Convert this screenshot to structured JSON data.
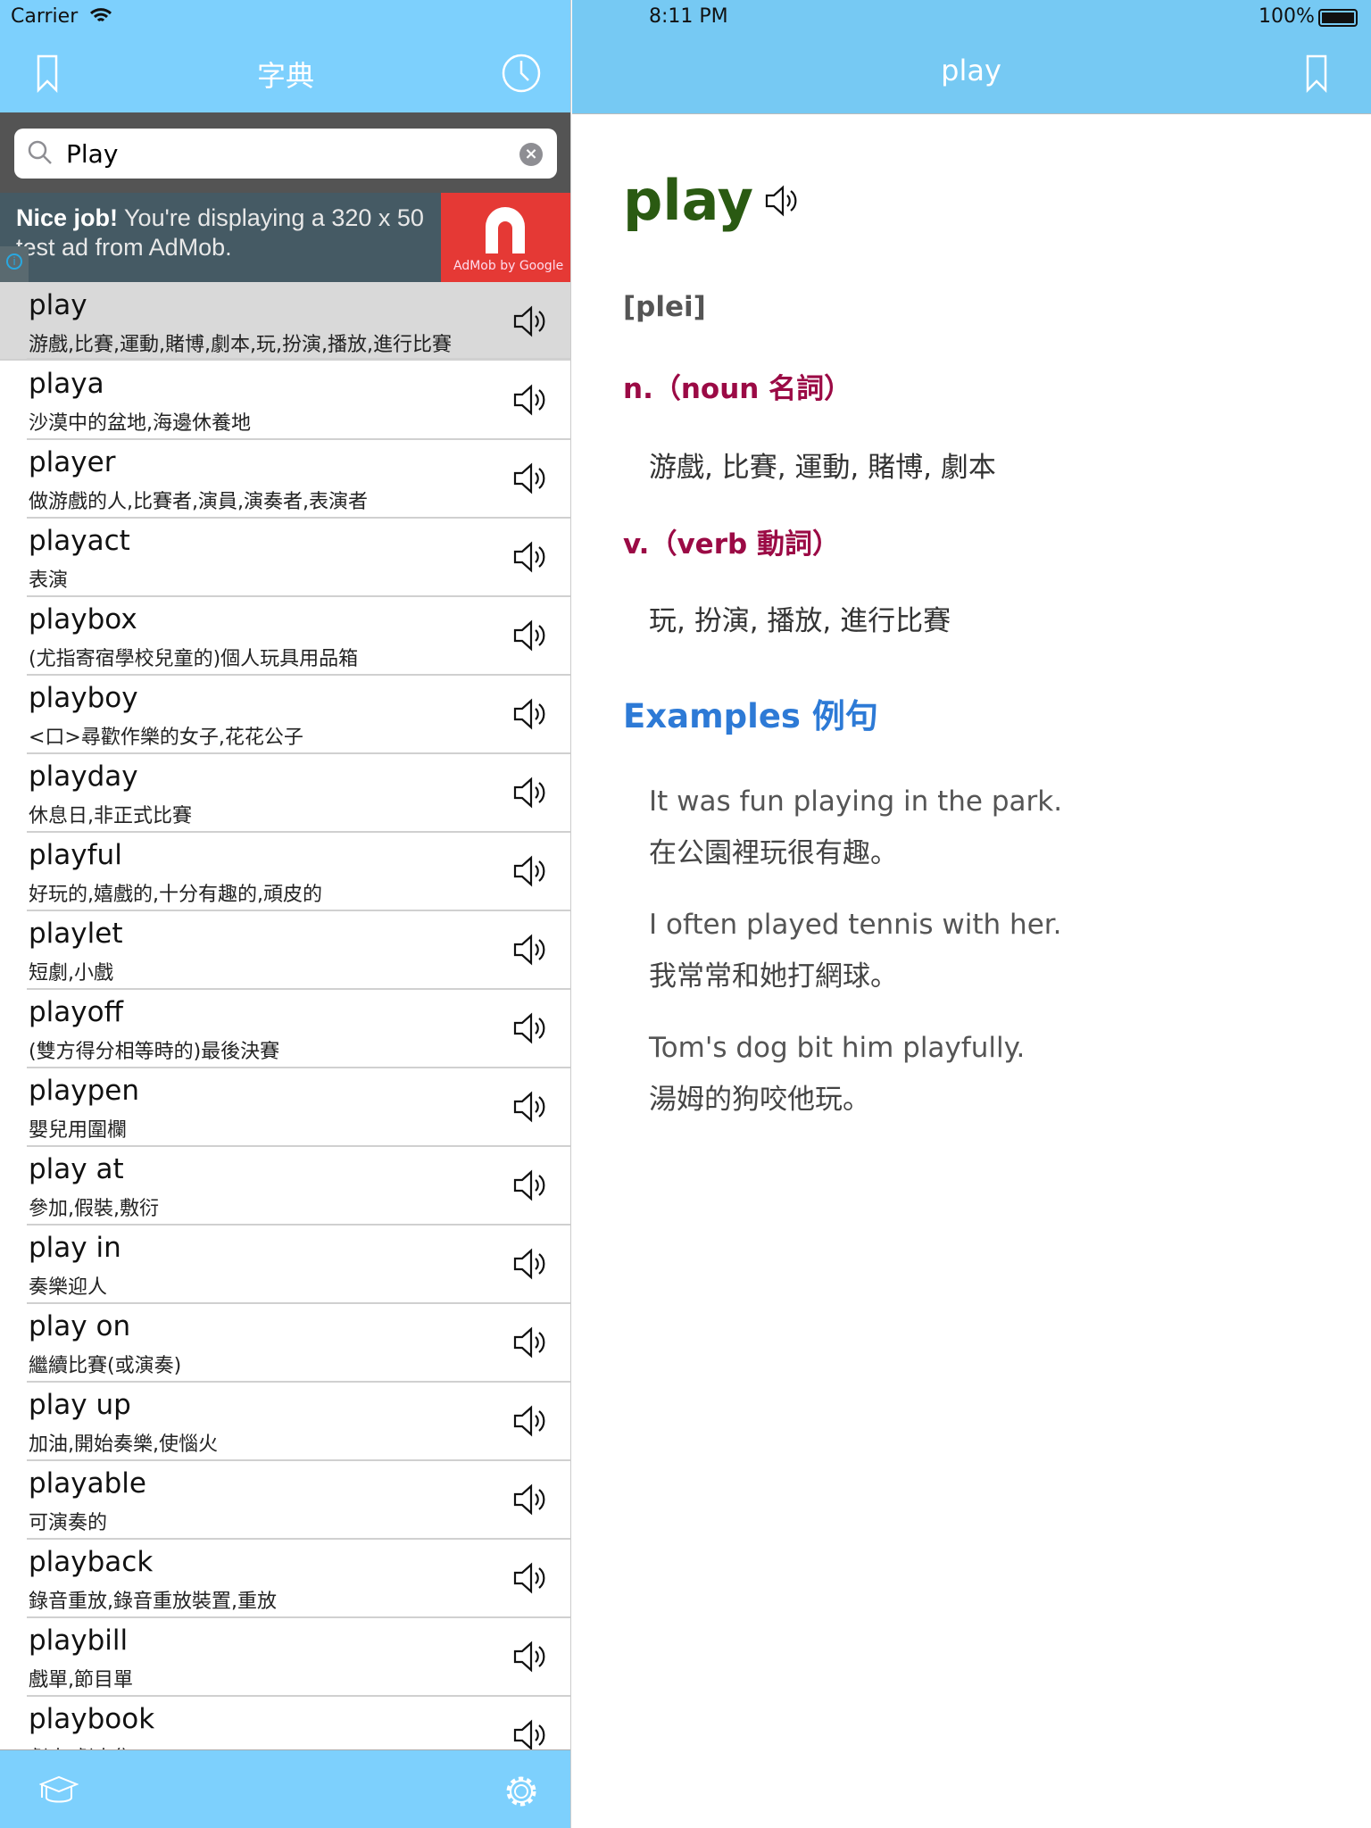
{
  "status": {
    "carrier": "Carrier",
    "time": "8:11 PM",
    "battery": "100%"
  },
  "left_nav": {
    "title": "字典",
    "left_icon": "bookmark-icon",
    "right_icon": "clock-icon"
  },
  "search": {
    "value": "Play",
    "placeholder": ""
  },
  "ad": {
    "bold": "Nice job!",
    "text": " You're displaying a 320 x 50 test ad from AdMob.",
    "logo_text": "AdMob by Google"
  },
  "results": [
    {
      "word": "play",
      "def": "游戲,比賽,運動,賭博,劇本,玩,扮演,播放,進行比賽"
    },
    {
      "word": "playa",
      "def": "沙漠中的盆地,海邊休養地"
    },
    {
      "word": "player",
      "def": "做游戲的人,比賽者,演員,演奏者,表演者"
    },
    {
      "word": "playact",
      "def": "表演"
    },
    {
      "word": "playbox",
      "def": "(尤指寄宿學校兒童的)個人玩具用品箱"
    },
    {
      "word": "playboy",
      "def": "<口>尋歡作樂的女子,花花公子"
    },
    {
      "word": "playday",
      "def": "休息日,非正式比賽"
    },
    {
      "word": "playful",
      "def": "好玩的,嬉戲的,十分有趣的,頑皮的"
    },
    {
      "word": "playlet",
      "def": "短劇,小戲"
    },
    {
      "word": "playoff",
      "def": "(雙方得分相等時的)最後決賽"
    },
    {
      "word": "playpen",
      "def": "嬰兒用圍欄"
    },
    {
      "word": "play at",
      "def": "參加,假裝,敷衍"
    },
    {
      "word": "play in",
      "def": "奏樂迎人"
    },
    {
      "word": "play on",
      "def": "繼續比賽(或演奏)"
    },
    {
      "word": "play up",
      "def": "加油,開始奏樂,使惱火"
    },
    {
      "word": "playable",
      "def": "可演奏的"
    },
    {
      "word": "playback",
      "def": "錄音重放,錄音重放裝置,重放"
    },
    {
      "word": "playbill",
      "def": "戲單,節目單"
    },
    {
      "word": "playbook",
      "def": "劇本,劇本集"
    }
  ],
  "selected_index": 0,
  "toolbar": {
    "left_icon": "graduation-cap-icon",
    "right_icon": "gear-icon"
  },
  "right_nav": {
    "title": "play",
    "right_icon": "bookmark-icon"
  },
  "entry": {
    "word": "play",
    "phonetic": "[plei]",
    "senses": [
      {
        "pos": "n.（noun 名詞）",
        "def": "游戲, 比賽, 運動, 賭博, 劇本"
      },
      {
        "pos": "v.（verb 動詞）",
        "def": "玩, 扮演, 播放, 進行比賽"
      }
    ],
    "examples_heading": "Examples 例句",
    "examples": [
      {
        "en": "It was fun playing in the park.",
        "zh": "在公園裡玩很有趣。"
      },
      {
        "en": "I often played tennis with her.",
        "zh": "我常常和她打網球。"
      },
      {
        "en": "Tom's dog bit him playfully.",
        "zh": "湯姆的狗咬他玩。"
      }
    ]
  },
  "colors": {
    "nav": "#7dd0fd",
    "word": "#2a5a12",
    "pos": "#9b0a45",
    "examples": "#2d7ad6",
    "ad_red": "#e53935"
  }
}
